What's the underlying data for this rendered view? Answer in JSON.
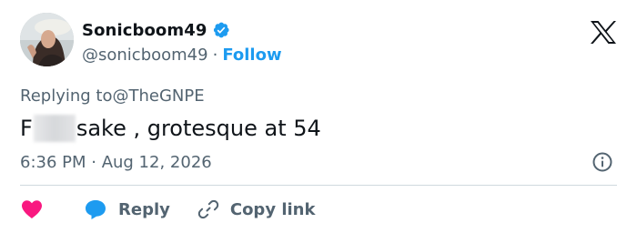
{
  "tweet": {
    "display_name": "Sonicboom49",
    "handle": "@sonicboom49",
    "separator": "·",
    "follow_label": "Follow",
    "replying_prefix": "Replying to ",
    "replying_to": "@TheGNPE",
    "text_before": "F",
    "text_after": "sake , grotesque at 54",
    "timestamp": "6:36 PM · Aug 12, 2026"
  },
  "actions": {
    "like": {
      "icon": "heart-icon",
      "label": ""
    },
    "reply": {
      "icon": "reply-bubble-icon",
      "label": "Reply"
    },
    "copy_link": {
      "icon": "link-icon",
      "label": "Copy link"
    }
  },
  "icons": {
    "verified": "verified-badge-icon",
    "platform": "x-logo-icon",
    "info": "info-icon"
  },
  "colors": {
    "accent_blue": "#1d9bf0",
    "like_pink": "#f91880",
    "text_primary": "#0f1419",
    "text_secondary": "#536471",
    "divider": "#cfd9de"
  }
}
